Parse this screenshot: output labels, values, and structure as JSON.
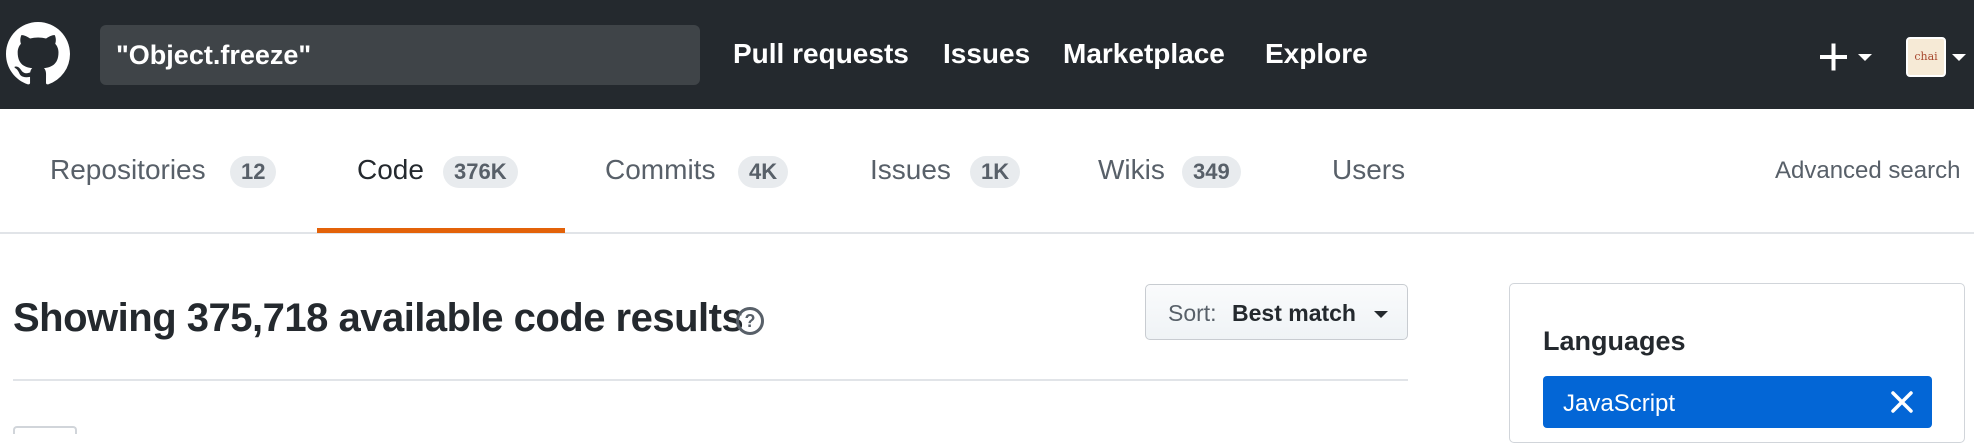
{
  "header": {
    "search_value": "\"Object.freeze\"",
    "nav": [
      "Pull requests",
      "Issues",
      "Marketplace",
      "Explore"
    ],
    "avatar_text": "chai"
  },
  "tabs": [
    {
      "label": "Repositories",
      "count": "12",
      "active": false
    },
    {
      "label": "Code",
      "count": "376K",
      "active": true
    },
    {
      "label": "Commits",
      "count": "4K",
      "active": false
    },
    {
      "label": "Issues",
      "count": "1K",
      "active": false
    },
    {
      "label": "Wikis",
      "count": "349",
      "active": false
    },
    {
      "label": "Users",
      "count": "",
      "active": false
    }
  ],
  "advanced_search": "Advanced search",
  "results": {
    "heading": "Showing 375,718 available code results",
    "help_glyph": "?",
    "sort_prefix": "Sort:",
    "sort_value": "Best match"
  },
  "languages": {
    "title": "Languages",
    "selected": "JavaScript"
  },
  "colors": {
    "header_bg": "#24292e",
    "active_tab_underline": "#e36209",
    "selected_language_bg": "#0366d6"
  }
}
